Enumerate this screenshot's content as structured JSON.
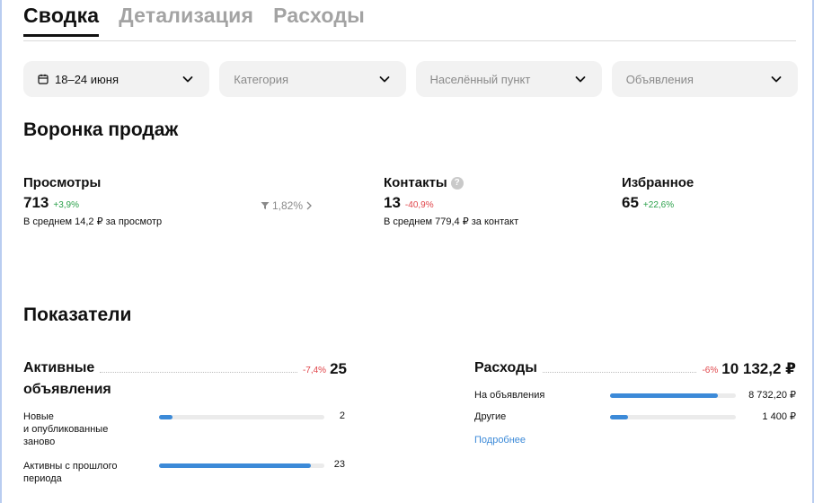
{
  "tabs": [
    {
      "label": "Сводка",
      "active": true
    },
    {
      "label": "Детализация",
      "active": false
    },
    {
      "label": "Расходы",
      "active": false
    }
  ],
  "filters": {
    "date": {
      "value": "18–24 июня",
      "icon": "calendar-icon"
    },
    "category": {
      "placeholder": "Категория"
    },
    "locality": {
      "placeholder": "Населённый пункт"
    },
    "ads": {
      "placeholder": "Объявления"
    }
  },
  "funnel": {
    "title": "Воронка продаж",
    "views": {
      "title": "Просмотры",
      "value": "713",
      "delta": "+3,9%",
      "sub": "В среднем 14,2 ₽ за просмотр"
    },
    "conversion": {
      "value": "1,82%",
      "icon": "filter-icon"
    },
    "contacts": {
      "title": "Контакты",
      "value": "13",
      "delta": "-40,9%",
      "sub": "В среднем 779,4 ₽ за контакт"
    },
    "favorites": {
      "title": "Избранное",
      "value": "65",
      "delta": "+22,6%"
    }
  },
  "indicators": {
    "title": "Показатели",
    "active": {
      "title_line1": "Активные",
      "title_line2": "объявления",
      "delta": "-7,4%",
      "total": "25",
      "rows": [
        {
          "label_lines": [
            "Новые",
            "и опубликованные",
            "заново"
          ],
          "value": "2",
          "fraction": 0.08
        },
        {
          "label_lines": [
            "Активны с прошлого",
            "периода"
          ],
          "value": "23",
          "fraction": 0.92
        }
      ]
    },
    "expenses": {
      "title": "Расходы",
      "delta": "-6%",
      "total": "10 132,2 ₽",
      "rows": [
        {
          "label": "На объявления",
          "value": "8 732,20 ₽",
          "fraction": 0.86
        },
        {
          "label": "Другие",
          "value": "1 400 ₽",
          "fraction": 0.14
        }
      ],
      "more_label": "Подробнее"
    }
  },
  "colors": {
    "accent": "#3c8ad8",
    "positive": "#2aa04a",
    "negative": "#e0454a"
  }
}
